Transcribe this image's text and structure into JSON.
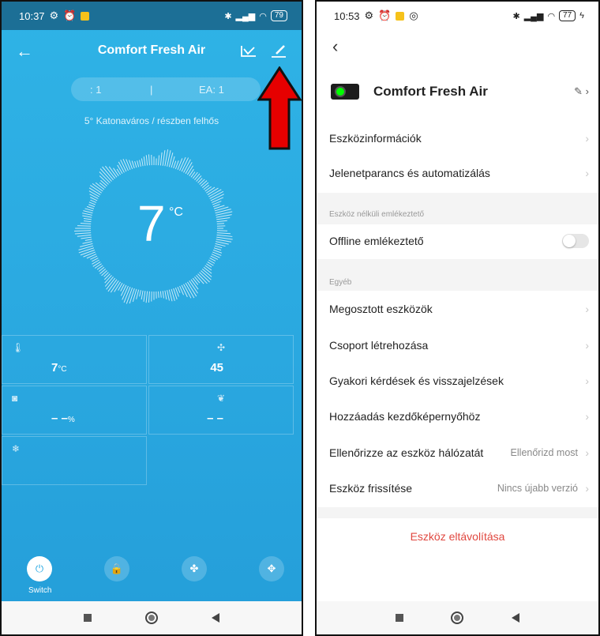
{
  "left": {
    "statusbar": {
      "time": "10:37",
      "battery": "79"
    },
    "header": {
      "title": "Comfort  Fresh Air"
    },
    "counters": {
      "left": ": 1",
      "sep": "|",
      "right": "EA: 1"
    },
    "weather": "5°  Katonaváros  /  részben felhős",
    "temp": {
      "value": "7",
      "unit": "°C"
    },
    "grid": [
      {
        "value": "7",
        "unit": "°C"
      },
      {
        "value": "45",
        "unit": ""
      },
      {
        "value": "– –",
        "unit": "%"
      },
      {
        "value": "– –",
        "unit": ""
      }
    ],
    "bottom": {
      "switch_label": "Switch"
    }
  },
  "right": {
    "statusbar": {
      "time": "10:53",
      "battery": "77"
    },
    "device": {
      "name": "Comfort  Fresh Air"
    },
    "menu": {
      "info": "Eszközinformációk",
      "scene": "Jelenetparancs és automatizálás",
      "section_offline": "Eszköz nélküli emlékeztető",
      "offline": "Offline emlékeztető",
      "section_other": "Egyéb",
      "shared": "Megosztott eszközök",
      "group": "Csoport létrehozása",
      "faq": "Gyakori kérdések és visszajelzések",
      "home": "Hozzáadás kezdőképernyőhöz",
      "network": "Ellenőrizze az eszköz hálózatát",
      "network_value": "Ellenőrizd most",
      "update": "Eszköz frissítése",
      "update_value": "Nincs újabb verzió",
      "remove": "Eszköz eltávolítása"
    }
  },
  "colors": {
    "accent": "#29a9e3",
    "arrow": "#e60000",
    "remove": "#e0473f"
  }
}
